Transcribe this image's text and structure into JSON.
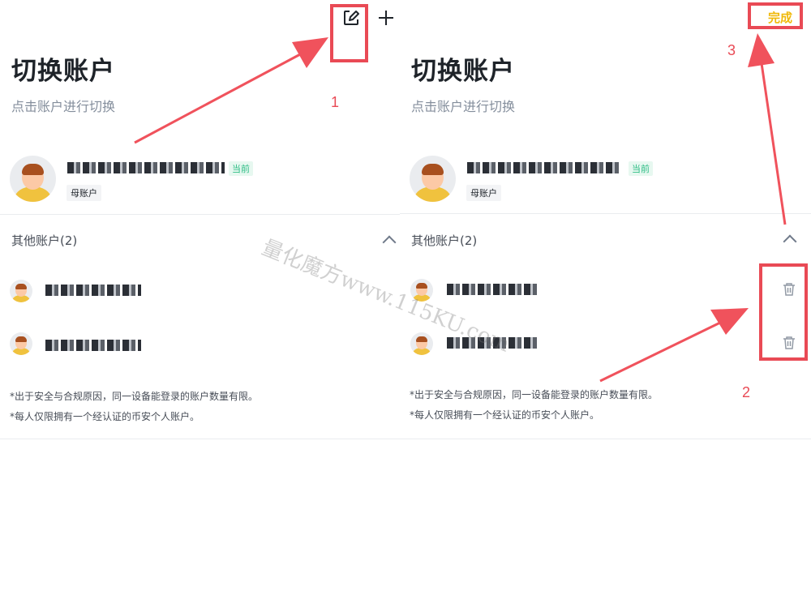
{
  "left": {
    "title": "切换账户",
    "subtitle": "点击账户进行切换",
    "current_account": {
      "current_badge": "当前",
      "type_badge": "母账户"
    },
    "other_section": {
      "label": "其他账户(2)"
    },
    "notes": [
      "*出于安全与合规原因，同一设备能登录的账户数量有限。",
      "*每人仅限拥有一个经认证的币安个人账户。"
    ],
    "icons": {
      "edit": "edit-icon",
      "add": "plus-icon"
    }
  },
  "right": {
    "title": "切换账户",
    "subtitle": "点击账户进行切换",
    "done_label": "完成",
    "current_account": {
      "current_badge": "当前",
      "type_badge": "母账户"
    },
    "other_section": {
      "label": "其他账户(2)"
    },
    "notes": [
      "*出于安全与合规原因，同一设备能登录的账户数量有限。",
      "*每人仅限拥有一个经认证的币安个人账户。"
    ],
    "icons": {
      "delete": "trash-icon"
    }
  },
  "annotations": {
    "step1": "1",
    "step2": "2",
    "step3": "3"
  },
  "watermark": "量化魔方www.115KU.com",
  "colors": {
    "annotation_red": "#e94a55",
    "accent_yellow": "#f0b90b",
    "badge_green": "#2ebd85"
  }
}
